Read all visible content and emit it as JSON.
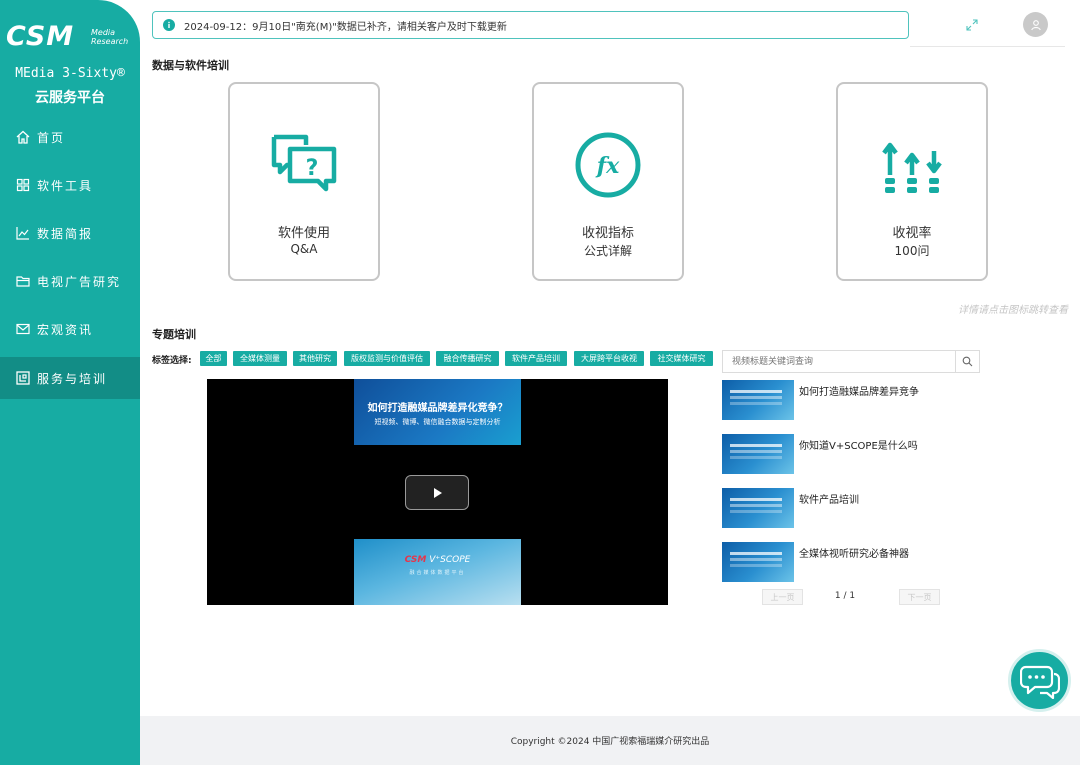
{
  "sidebar": {
    "logo": {
      "main": "CSM",
      "sub_line1": "Media",
      "sub_line2": "Research"
    },
    "product_name": "MEdia 3-Sixty®",
    "platform_name": "云服务平台",
    "items": [
      {
        "label": "首页",
        "icon": "home-icon",
        "active": false
      },
      {
        "label": "软件工具",
        "icon": "grid-icon",
        "active": false
      },
      {
        "label": "数据简报",
        "icon": "line-chart-icon",
        "active": false
      },
      {
        "label": "电视广告研究",
        "icon": "folder-icon",
        "active": false
      },
      {
        "label": "宏观资讯",
        "icon": "mail-icon",
        "active": false
      },
      {
        "label": "服务与培训",
        "icon": "service-icon",
        "active": true
      }
    ]
  },
  "topbar": {
    "notice": "2024-09-12：9月10日\"南充(M)\"数据已补齐，请相关客户及时下载更新",
    "notice_icon": "info-icon",
    "expand_icon": "expand-icon",
    "avatar_icon": "user-icon"
  },
  "data_training": {
    "title": "数据与软件培训",
    "cards": [
      {
        "line1": "软件使用",
        "line2": "Q&A",
        "icon": "chat-question-icon"
      },
      {
        "line1": "收视指标",
        "line2": "公式详解",
        "icon": "fx-icon"
      },
      {
        "line1": "收视率",
        "line2": "100问",
        "icon": "ratings-arrows-icon"
      }
    ],
    "hint": "详情请点击图标跳转查看"
  },
  "topic_training": {
    "title": "专题培训",
    "tag_label": "标签选择:",
    "tags": [
      "全部",
      "全媒体测量",
      "其他研究",
      "版权监测与价值评估",
      "融合传播研究",
      "软件产品培训",
      "大屏跨平台收视",
      "社交媒体研究"
    ],
    "video": {
      "slide_title": "如何打造融媒品牌差异化竞争？",
      "slide_subtitle": "短视频、微博、微信融合数据与定制分析",
      "slide_logo_csm": "CSM",
      "slide_logo_rest": " V⁺SCOPE",
      "slide_tagline": "融合媒体数据平台"
    },
    "search_placeholder": "视频标题关键词查询",
    "videos": [
      {
        "title": "如何打造融媒品牌差异竞争"
      },
      {
        "title": "你知道V+SCOPE是什么吗"
      },
      {
        "title": "软件产品培训"
      },
      {
        "title": "全媒体视听研究必备神器"
      }
    ],
    "pager": {
      "prev": "上一页",
      "info": "1 / 1",
      "next": "下一页"
    }
  },
  "footer": {
    "copyright": "Copyright ©2024 中国广视索福瑞媒介研究出品"
  },
  "colors": {
    "accent": "#17aca3",
    "active_nav": "#128d86",
    "footer_bg": "#f1f2f4"
  }
}
